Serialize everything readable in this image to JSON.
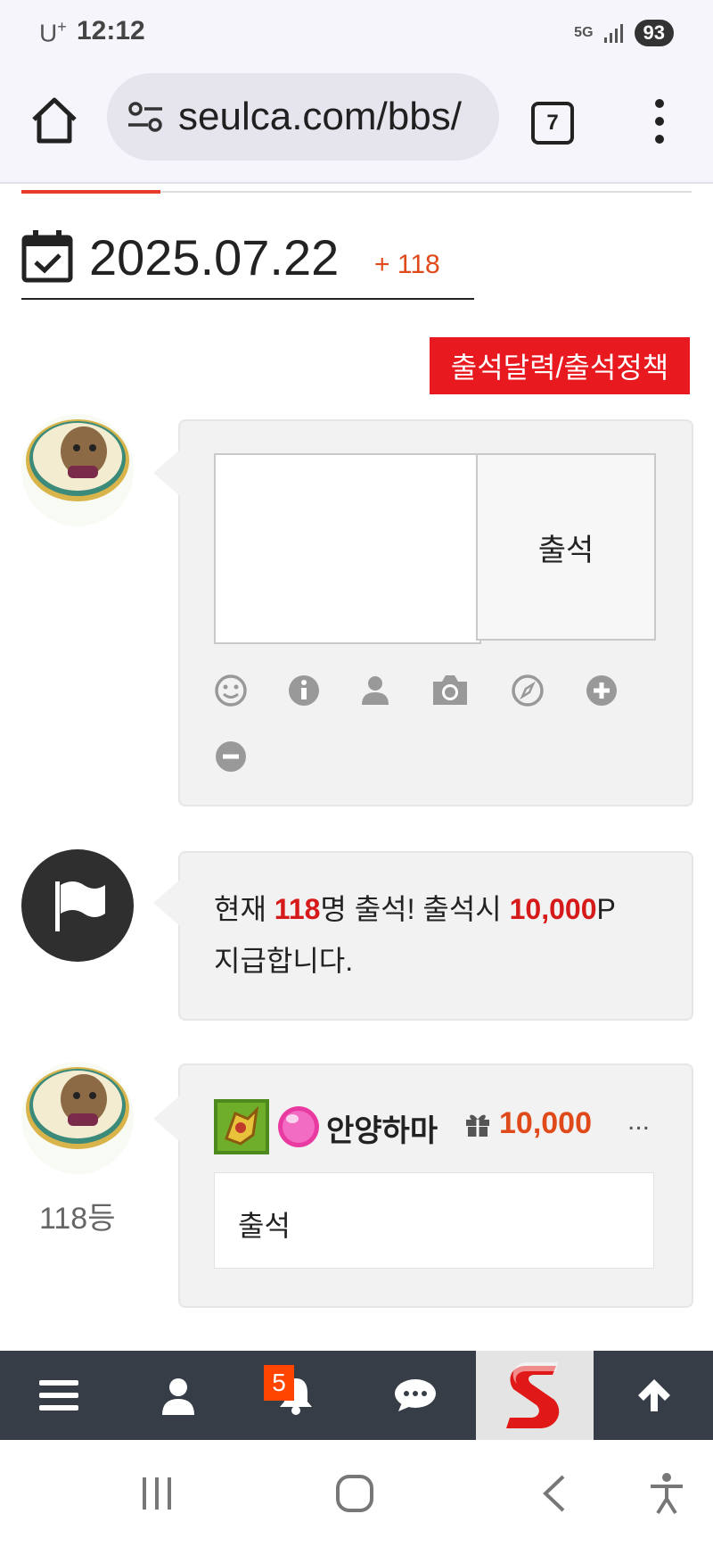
{
  "status_bar": {
    "carrier": "U",
    "carrier_sup": "+",
    "time": "12:12",
    "network": "5G",
    "battery": "93"
  },
  "browser": {
    "url": "seulca.com/bbs/",
    "tab_count": "7"
  },
  "page": {
    "date": "2025.07.22",
    "date_count": "+ 118",
    "policy_button": "출석달력/출석정책",
    "submit_button": "출석",
    "notice": {
      "prefix": "현재 ",
      "count": "118",
      "mid": "명 출석! 출석시 ",
      "points": "10,000",
      "suffix": "P",
      "line2": "지급합니다."
    },
    "comment": {
      "nickname": "안양하마",
      "points": "10,000",
      "more": "...",
      "text": "출석",
      "rank": "118등"
    }
  },
  "bottom_nav": {
    "notification_badge": "5"
  },
  "colors": {
    "accent": "#e8191f",
    "points": "#e04a1a",
    "nav_bg": "#363d47"
  }
}
